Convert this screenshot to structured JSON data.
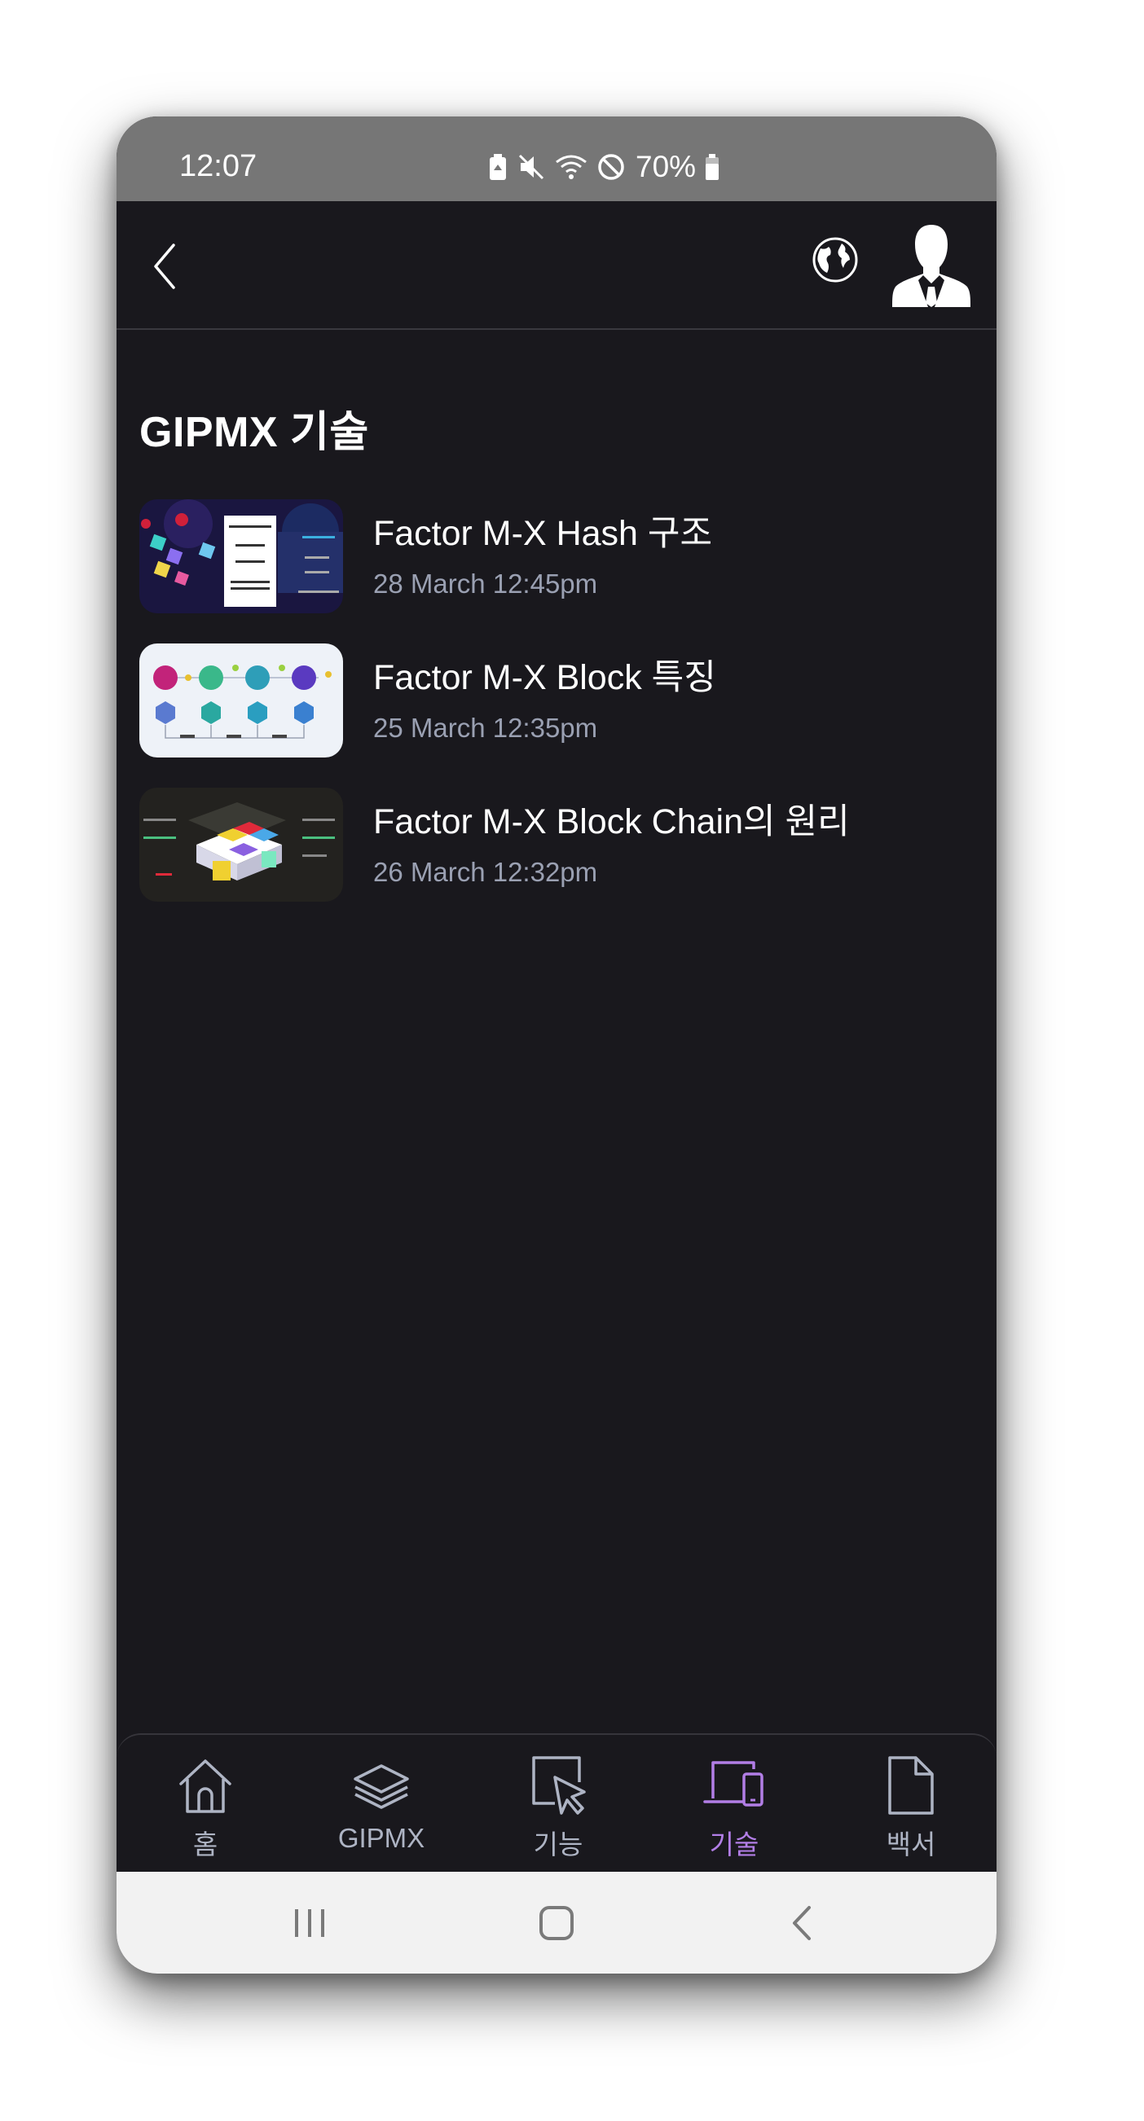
{
  "status_bar": {
    "time": "12:07",
    "battery": "70%"
  },
  "page": {
    "title": "GIPMX 기술"
  },
  "articles": [
    {
      "title": "Factor M-X Hash 구조",
      "date": "28 March 12:45pm"
    },
    {
      "title": "Factor M-X Block 특징",
      "date": "25 March 12:35pm"
    },
    {
      "title": "Factor M-X Block Chain의 원리",
      "date": "26 March 12:32pm"
    }
  ],
  "bottom_nav": {
    "items": [
      {
        "label": "홈",
        "icon": "home-icon"
      },
      {
        "label": "GIPMX",
        "icon": "layers-icon"
      },
      {
        "label": "기능",
        "icon": "pointer-icon"
      },
      {
        "label": "기술",
        "icon": "devices-icon",
        "active": true
      },
      {
        "label": "백서",
        "icon": "document-icon"
      }
    ]
  },
  "colors": {
    "background": "#19181d",
    "status_bar": "#767676",
    "accent": "#b27ee6",
    "date_text": "#9aa0b2",
    "nav_text": "#aeb4c4"
  }
}
